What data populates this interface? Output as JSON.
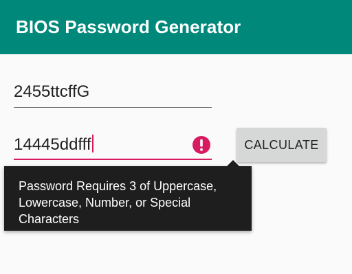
{
  "appbar": {
    "title": "BIOS Password Generator",
    "color": "#00897b"
  },
  "form": {
    "field1": {
      "value": "2455ttcffG"
    },
    "field2": {
      "value": "14445ddfff",
      "error_color": "#d81b60"
    },
    "error_icon": "error-exclamation-icon",
    "calculate_label": "CALCULATE"
  },
  "tooltip": {
    "message": "Password Requires 3 of Uppercase, Lowercase, Number, or Special Characters"
  }
}
